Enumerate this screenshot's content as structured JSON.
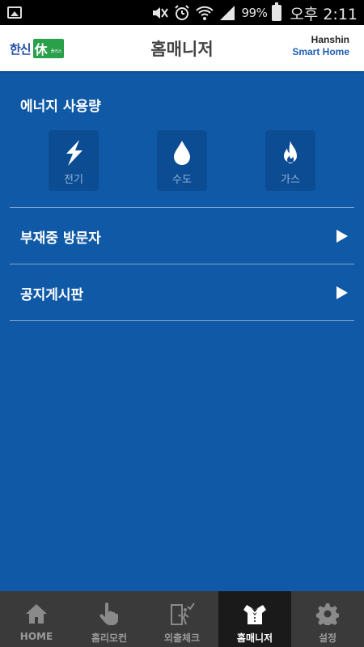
{
  "status_bar": {
    "battery": "99%",
    "time": "오후 2:11",
    "icons": [
      "gallery-icon",
      "mute-icon",
      "alarm-icon",
      "wifi-icon",
      "signal-icon",
      "battery-icon"
    ]
  },
  "header": {
    "logo_text": "한신",
    "logo_mark": "休",
    "logo_sub": "플러스",
    "title": "홈매니저",
    "brand_line1": "Hanshin",
    "brand_line2": "Smart Home"
  },
  "energy": {
    "title": "에너지 사용량",
    "items": [
      {
        "label": "전기",
        "icon": "lightning-icon"
      },
      {
        "label": "수도",
        "icon": "water-drop-icon"
      },
      {
        "label": "가스",
        "icon": "flame-icon"
      }
    ]
  },
  "list": [
    {
      "label": "부재중 방문자",
      "icon": "arrow-right-icon"
    },
    {
      "label": "공지게시판",
      "icon": "arrow-right-icon"
    }
  ],
  "bottom_nav": [
    {
      "label": "HOME",
      "icon": "home-icon",
      "active": false
    },
    {
      "label": "홈리모컨",
      "icon": "hand-pointer-icon",
      "active": false
    },
    {
      "label": "외출체크",
      "icon": "door-check-icon",
      "active": false
    },
    {
      "label": "홈매니저",
      "icon": "butler-icon",
      "active": true
    },
    {
      "label": "설정",
      "icon": "gear-icon",
      "active": false
    }
  ],
  "colors": {
    "background": "#1059a7",
    "tile": "#0c4c93",
    "nav_bg": "#3a3a3a",
    "nav_active": "#1a1a1a",
    "brand_green": "#2aa04a",
    "brand_blue": "#1d4ea3"
  }
}
